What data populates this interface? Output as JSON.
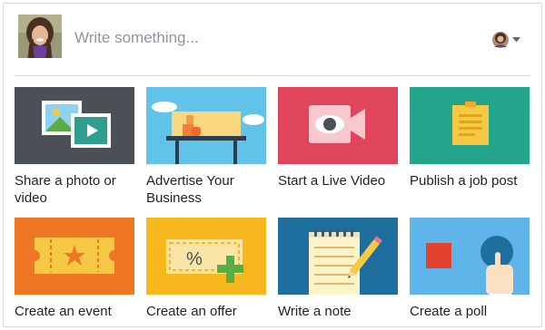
{
  "composer": {
    "placeholder": "Write something..."
  },
  "options": [
    {
      "label": "Share a photo or video",
      "icon": "photo-video-icon",
      "bg": "#4b4f56"
    },
    {
      "label": "Advertise Your Business",
      "icon": "storefront-icon",
      "bg": "#62c3e8"
    },
    {
      "label": "Start a Live Video",
      "icon": "live-video-icon",
      "bg": "#e0455b"
    },
    {
      "label": "Publish a job post",
      "icon": "sticky-note-icon",
      "bg": "#23a58b"
    },
    {
      "label": "Create an event",
      "icon": "ticket-icon",
      "bg": "#ef7622"
    },
    {
      "label": "Create an offer",
      "icon": "coupon-icon",
      "bg": "#f6b81c"
    },
    {
      "label": "Write a note",
      "icon": "notepad-pencil-icon",
      "bg": "#1f6f9e"
    },
    {
      "label": "Create a poll",
      "icon": "poll-icon",
      "bg": "#5fb4e9"
    }
  ]
}
